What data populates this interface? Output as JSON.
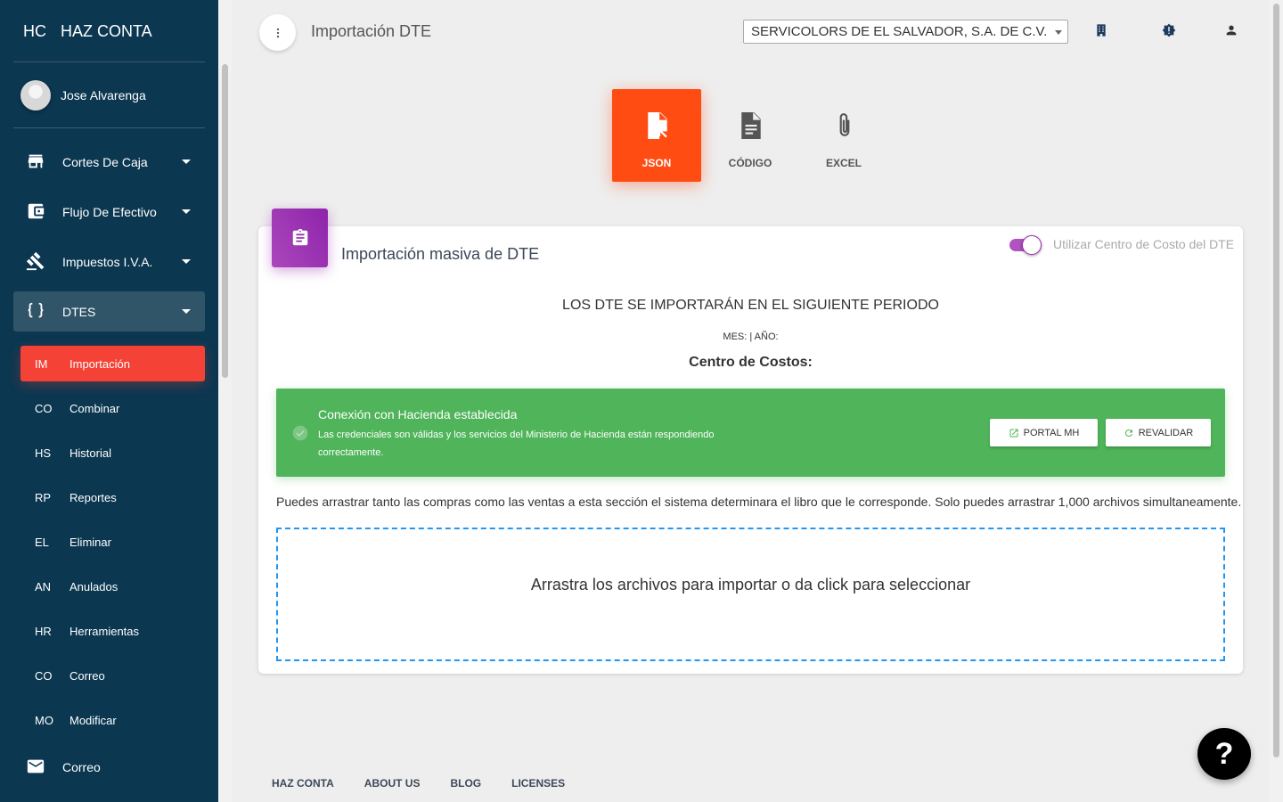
{
  "brand": {
    "mini": "HC",
    "name": "HAZ CONTA"
  },
  "user": {
    "name": "Jose Alvarenga"
  },
  "sidebar": {
    "items": [
      {
        "label": "Cortes De Caja",
        "icon": "store-icon"
      },
      {
        "label": "Flujo De Efectivo",
        "icon": "wallet-icon"
      },
      {
        "label": "Impuestos I.V.A.",
        "icon": "gavel-icon"
      },
      {
        "label": "DTES",
        "icon": "braces-icon"
      }
    ],
    "subitems": [
      {
        "abbr": "IM",
        "label": "Importación"
      },
      {
        "abbr": "CO",
        "label": "Combinar"
      },
      {
        "abbr": "HS",
        "label": "Historial"
      },
      {
        "abbr": "RP",
        "label": "Reportes"
      },
      {
        "abbr": "EL",
        "label": "Eliminar"
      },
      {
        "abbr": "AN",
        "label": "Anulados"
      },
      {
        "abbr": "HR",
        "label": "Herramientas"
      },
      {
        "abbr": "CO",
        "label": "Correo"
      },
      {
        "abbr": "MO",
        "label": "Modificar"
      }
    ],
    "mail": {
      "label": "Correo",
      "icon": "mail-icon"
    }
  },
  "header": {
    "title": "Importación DTE",
    "company": "SERVICOLORS DE EL SALVADOR, S.A. DE C.V."
  },
  "tabs": [
    {
      "label": "JSON",
      "active": true
    },
    {
      "label": "CÓDIGO",
      "active": false
    },
    {
      "label": "EXCEL",
      "active": false
    }
  ],
  "card": {
    "title": "Importación masiva de DTE",
    "toggle_label": "Utilizar Centro de Costo del DTE",
    "toggle_on": true,
    "period_title": "LOS DTE SE IMPORTARÁN EN EL SIGUIENTE PERIODO",
    "period_values": "MES: | AÑO:",
    "cost_center": "Centro de Costos:"
  },
  "alert": {
    "title": "Conexión con Hacienda establecida",
    "message": "Las credenciales son válidas y los servicios del Ministerio de Hacienda están respondiendo correctamente.",
    "btn_portal": "PORTAL MH",
    "btn_revalidate": "REVALIDAR"
  },
  "drag_note": "Puedes arrastrar tanto las compras como las ventas a esta sección el sistema determinara el libro que le corresponde. Solo puedes arrastrar 1,000 archivos simultaneamente.",
  "dropzone": {
    "text": "Arrastra los archivos para importar o da click para seleccionar"
  },
  "footer": {
    "links": [
      "HAZ CONTA",
      "ABOUT US",
      "BLOG",
      "LICENSES"
    ]
  },
  "help": {
    "label": "?"
  },
  "colors": {
    "sidebar": "#0b3751",
    "active": "#f44336",
    "tab_active": "#ff4c13",
    "success": "#4fb45a",
    "purple": "#9c27b0"
  }
}
